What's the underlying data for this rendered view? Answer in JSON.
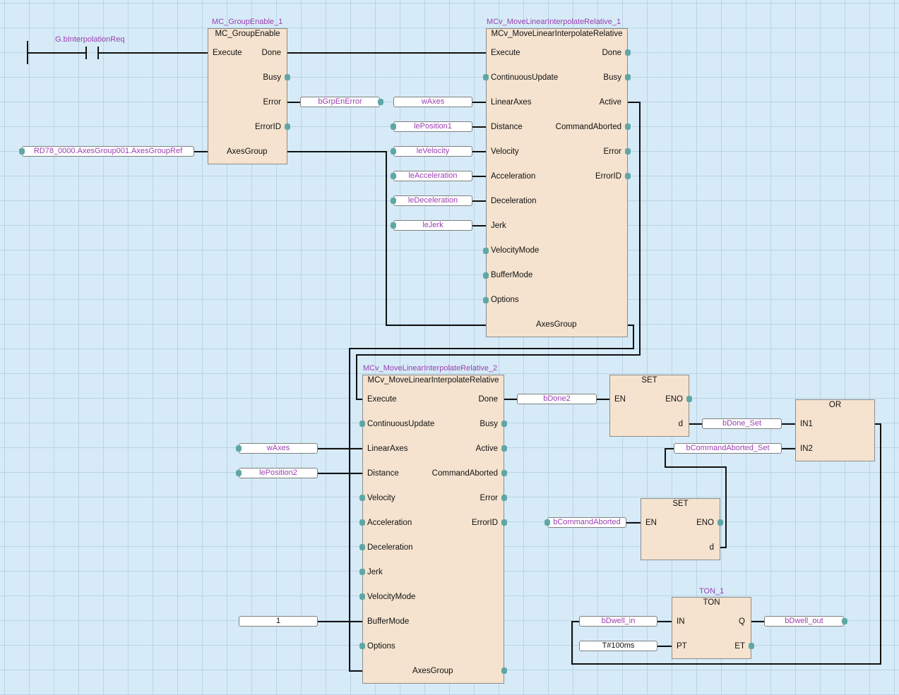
{
  "contact": {
    "label": "G.bInterpolationReq"
  },
  "blocks": {
    "gen": {
      "instance": "MC_GroupEnable_1",
      "type": "MC_GroupEnable",
      "inputs": [
        "Execute",
        "AxesGroup"
      ],
      "outputs": [
        "Done",
        "Busy",
        "Error",
        "ErrorID"
      ]
    },
    "lin1": {
      "instance": "MCv_MoveLinearInterpolateRelative_1",
      "type": "MCv_MoveLinearInterpolateRelative",
      "inputs": [
        "Execute",
        "ContinuousUpdate",
        "LinearAxes",
        "Distance",
        "Velocity",
        "Acceleration",
        "Deceleration",
        "Jerk",
        "VelocityMode",
        "BufferMode",
        "Options",
        "AxesGroup"
      ],
      "outputs": [
        "Done",
        "Busy",
        "Active",
        "CommandAborted",
        "Error",
        "ErrorID"
      ]
    },
    "lin2": {
      "instance": "MCv_MoveLinearInterpolateRelative_2",
      "type": "MCv_MoveLinearInterpolateRelative",
      "inputs": [
        "Execute",
        "ContinuousUpdate",
        "LinearAxes",
        "Distance",
        "Velocity",
        "Acceleration",
        "Deceleration",
        "Jerk",
        "VelocityMode",
        "BufferMode",
        "Options"
      ],
      "outputs": [
        "Done",
        "Busy",
        "Active",
        "CommandAborted",
        "Error",
        "ErrorID",
        "AxesGroup"
      ]
    },
    "set1": {
      "type": "SET",
      "inputs": [
        "EN"
      ],
      "outputs": [
        "ENO",
        "d"
      ]
    },
    "set2": {
      "type": "SET",
      "inputs": [
        "EN"
      ],
      "outputs": [
        "ENO",
        "d"
      ]
    },
    "or": {
      "type": "OR",
      "inputs": [
        "IN1",
        "IN2"
      ]
    },
    "ton": {
      "instance": "TON_1",
      "type": "TON",
      "inputs": [
        "IN",
        "PT"
      ],
      "outputs": [
        "Q",
        "ET"
      ]
    }
  },
  "variables": {
    "axes_group_ref": "RD78_0000.AxesGroup001.AxesGroupRef",
    "grp_en_error": "bGrpEnError",
    "waxes_1": "wAxes",
    "le_position1": "lePosition1",
    "le_velocity": "leVelocity",
    "le_acceleration": "leAcceleration",
    "le_deceleration": "leDeceleration",
    "le_jerk": "leJerk",
    "waxes_2": "wAxes",
    "le_position2": "lePosition2",
    "buffer_mode_const": "1",
    "done2": "bDone2",
    "done_set": "bDone_Set",
    "cmd_aborted_set": "bCommandAborted_Set",
    "cmd_aborted": "bCommandAborted",
    "dwell_in": "bDwell_in",
    "pt_const": "T#100ms",
    "dwell_out": "bDwell_out"
  }
}
